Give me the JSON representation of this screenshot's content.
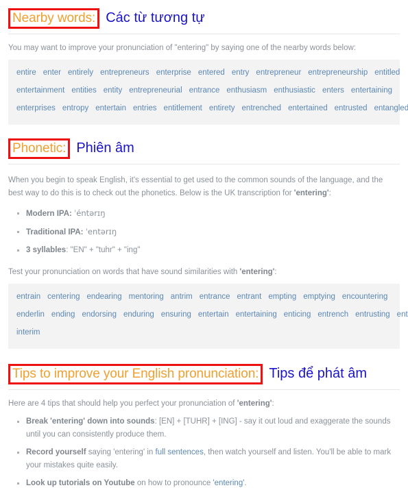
{
  "colors": {
    "heading_en": "#f0a030",
    "heading_border": "#ee1111",
    "heading_vi": "#1a14c8",
    "body_text": "#8a9199",
    "link": "#5b87b5",
    "panel_bg": "#f3f3f4",
    "rule": "#e7e7e7"
  },
  "target_word": "entering",
  "sections": {
    "nearby": {
      "heading_en": "Nearby words:",
      "heading_vi": "Các từ tương tự",
      "intro": "You may want to improve your pronunciation of \"entering\" by saying one of the nearby words below:",
      "word_lines": [
        [
          "entire",
          "enter",
          "entirely",
          "entrepreneurs",
          "enterprise",
          "entered",
          "entry",
          "entrepreneur",
          "entrepreneurship",
          "entitled"
        ],
        [
          "entertainment",
          "entities",
          "entity",
          "entrepreneurial",
          "entrance",
          "enthusiasm",
          "enthusiastic",
          "enters",
          "entertaining"
        ],
        [
          "enterprises",
          "entropy",
          "entertain",
          "entries",
          "entitlement",
          "entirety",
          "entrenched",
          "entertained",
          "entrusted",
          "entangled"
        ]
      ]
    },
    "phonetic": {
      "heading_en": "Phonetic:",
      "heading_vi": "Phiên âm",
      "para_part1": "When you begin to speak English, it's essential to get used to the common sounds of the language, and the best way to do this is to check out the phonetics. Below is the UK transcription for ",
      "para_word": "'entering'",
      "para_part2": ":",
      "items": [
        {
          "label": "Modern IPA:",
          "value": "ˈéntərɪŋ"
        },
        {
          "label": "Traditional IPA:",
          "value": "ˈentərɪŋ"
        },
        {
          "label": "3 syllables",
          "value": ": \"EN\" + \"tuhr\" + \"ing\""
        }
      ],
      "test_intro_part1": "Test your pronunciation on words that have sound similarities with ",
      "test_intro_word": "'entering'",
      "test_intro_part2": ":",
      "word_lines": [
        [
          "entrain",
          "centering",
          "endearing",
          "mentoring",
          "antrim",
          "entrance",
          "entrant",
          "empting",
          "emptying",
          "encountering"
        ],
        [
          "enderlin",
          "ending",
          "endorsing",
          "enduring",
          "ensuring",
          "entertain",
          "entertaining",
          "enticing",
          "entrench",
          "entrusting",
          "entry"
        ],
        [
          "interim"
        ]
      ]
    },
    "tips": {
      "heading_en": "Tips to improve your English pronunciation:",
      "heading_vi": "Tips để phát âm",
      "intro_part1": "Here are 4 tips that should help you perfect your pronunciation of ",
      "intro_word": "'entering'",
      "intro_part2": ":",
      "items": [
        {
          "bold": "Break 'entering' down into sounds",
          "rest": ": [EN] + [TUHR] + [ING] - say it out loud and exaggerate the sounds until you can consistently produce them."
        },
        {
          "bold": "Record yourself",
          "mid1": " saying 'entering' in ",
          "link": "full sentences",
          "mid2": ", then watch yourself and listen. You'll be able to mark your mistakes quite easily."
        },
        {
          "bold": "Look up tutorials on Youtube",
          "mid1": " on how to pronounce ",
          "link": "'entering'",
          "mid2": "."
        }
      ]
    }
  }
}
